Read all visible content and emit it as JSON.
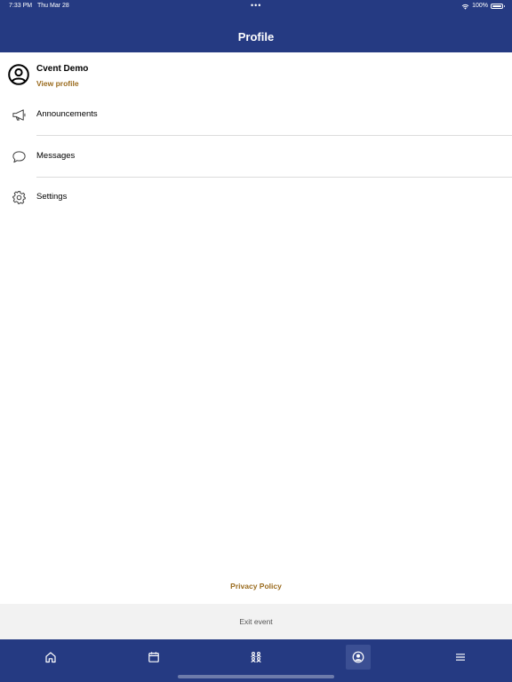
{
  "status": {
    "time": "7:33 PM",
    "date": "Thu Mar 28",
    "dots": "•••",
    "battery": "100%"
  },
  "header": {
    "title": "Profile"
  },
  "profile": {
    "name": "Cvent Demo",
    "view_profile_label": "View profile"
  },
  "menu": [
    {
      "label": "Announcements",
      "icon": "megaphone-icon"
    },
    {
      "label": "Messages",
      "icon": "chat-bubble-icon"
    },
    {
      "label": "Settings",
      "icon": "gear-icon"
    }
  ],
  "footer": {
    "privacy_label": "Privacy Policy",
    "exit_label": "Exit event"
  },
  "tabbar": {
    "tabs": [
      {
        "icon": "home-icon",
        "active": false
      },
      {
        "icon": "calendar-icon",
        "active": false
      },
      {
        "icon": "people-icon",
        "active": false
      },
      {
        "icon": "profile-icon",
        "active": true
      },
      {
        "icon": "menu-icon",
        "active": false
      }
    ]
  },
  "colors": {
    "brand": "#253a82",
    "accent": "#9a6b1e",
    "exit_bg": "#f2f2f2"
  }
}
